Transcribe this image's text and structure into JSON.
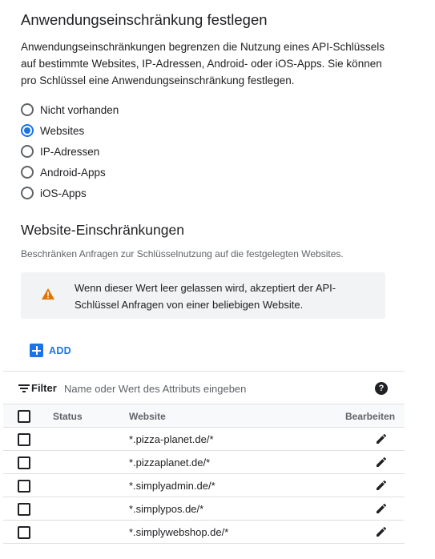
{
  "restriction": {
    "title": "Anwendungseinschränkung festlegen",
    "description": "Anwendungseinschränkungen begrenzen die Nutzung eines API-Schlüssels auf bestimmte Websites, IP-Adressen, Android- oder iOS-Apps. Sie können pro Schlüssel eine Anwendungseinschränkung festlegen.",
    "options": [
      {
        "label": "Nicht vorhanden",
        "selected": false
      },
      {
        "label": "Websites",
        "selected": true
      },
      {
        "label": "IP-Adressen",
        "selected": false
      },
      {
        "label": "Android-Apps",
        "selected": false
      },
      {
        "label": "iOS-Apps",
        "selected": false
      }
    ]
  },
  "website_restrictions": {
    "title": "Website-Einschränkungen",
    "description": "Beschränken Anfragen zur Schlüsselnutzung auf die festgelegten Websites.",
    "warning": "Wenn dieser Wert leer gelassen wird, akzeptiert der API-Schlüssel Anfragen von einer beliebigen Website.",
    "add_label": "ADD"
  },
  "filter": {
    "label": "Filter",
    "placeholder": "Name oder Wert des Attributs eingeben",
    "value": ""
  },
  "table": {
    "headers": {
      "status": "Status",
      "website": "Website",
      "edit": "Bearbeiten"
    },
    "rows": [
      {
        "website": "*.pizza-planet.de/*"
      },
      {
        "website": "*.pizzaplanet.de/*"
      },
      {
        "website": "*.simplyadmin.de/*"
      },
      {
        "website": "*.simplypos.de/*"
      },
      {
        "website": "*.simplywebshop.de/*"
      }
    ]
  },
  "colors": {
    "accent": "#1a73e8",
    "warning": "#e37400",
    "warning_bg": "#f1f3f4"
  },
  "icons": {
    "warning": "warning-triangle-icon",
    "add": "add-box-icon",
    "filter": "filter-list-icon",
    "help": "help-icon",
    "edit": "pencil-icon"
  }
}
